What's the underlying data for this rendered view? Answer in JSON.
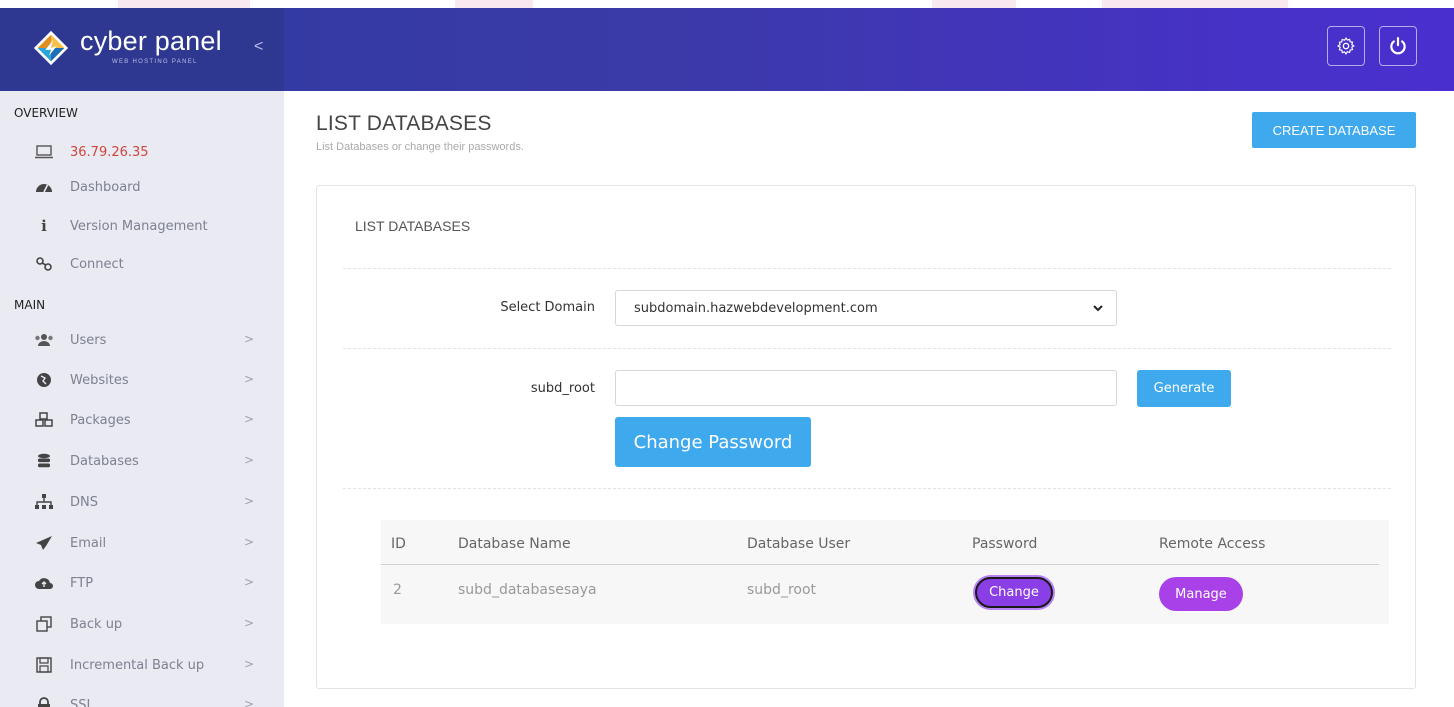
{
  "brand": {
    "name": "cyber panel",
    "subtitle": "WEB HOSTING PANEL",
    "collapse": "<"
  },
  "header": {
    "settings_icon": "gear-icon",
    "power_icon": "power-icon"
  },
  "sidebar": {
    "overview_label": "OVERVIEW",
    "main_label": "MAIN",
    "overview_items": [
      {
        "label": "36.79.26.35",
        "icon": "monitor-icon"
      },
      {
        "label": "Dashboard",
        "icon": "dashboard-icon"
      },
      {
        "label": "Version Management",
        "icon": "info-icon"
      },
      {
        "label": "Connect",
        "icon": "link-icon"
      }
    ],
    "main_items": [
      {
        "label": "Users",
        "icon": "users-icon"
      },
      {
        "label": "Websites",
        "icon": "globe-icon"
      },
      {
        "label": "Packages",
        "icon": "cubes-icon"
      },
      {
        "label": "Databases",
        "icon": "database-icon"
      },
      {
        "label": "DNS",
        "icon": "sitemap-icon"
      },
      {
        "label": "Email",
        "icon": "send-icon"
      },
      {
        "label": "FTP",
        "icon": "cloud-upload-icon"
      },
      {
        "label": "Back up",
        "icon": "copy-icon"
      },
      {
        "label": "Incremental Back up",
        "icon": "save-icon"
      },
      {
        "label": "SSL",
        "icon": "lock-icon"
      }
    ],
    "chevron": ">"
  },
  "page": {
    "title": "LIST DATABASES",
    "subtitle": "List Databases or change their passwords.",
    "create_button": "CREATE DATABASE"
  },
  "card": {
    "title": "LIST DATABASES",
    "select_domain_label": "Select Domain",
    "select_domain_value": "subdomain.hazwebdevelopment.com",
    "user_label": "subd_root",
    "password_value": "",
    "generate_button": "Generate",
    "change_password_button": "Change Password"
  },
  "table": {
    "headers": [
      "ID",
      "Database Name",
      "Database User",
      "Password",
      "Remote Access"
    ],
    "rows": [
      {
        "id": "2",
        "name": "subd_databasesaya",
        "user": "subd_root",
        "password_button": "Change",
        "remote_button": "Manage"
      }
    ]
  },
  "colors": {
    "header": "#3b3aa8",
    "accent": "#3fa9ee",
    "purple": "#a842e8",
    "ip": "#d0463c"
  }
}
